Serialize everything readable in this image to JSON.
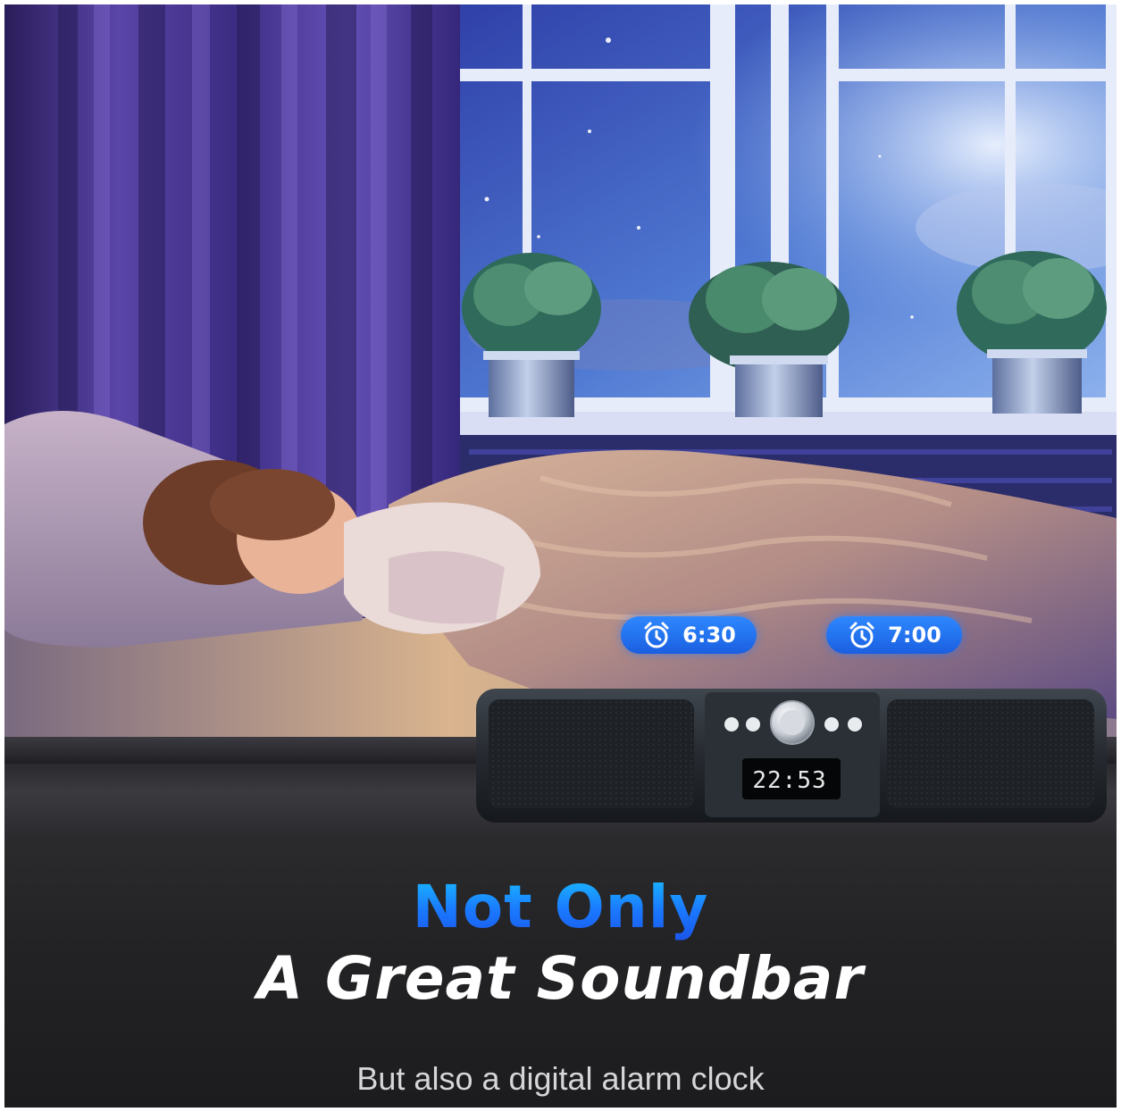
{
  "headline": {
    "line1": "Not Only",
    "line2": "A Great Soundbar",
    "subline": "But also a digital alarm clock"
  },
  "alarms": [
    {
      "time": "6:30",
      "icon": "alarm-clock-icon"
    },
    {
      "time": "7:00",
      "icon": "alarm-clock-icon"
    }
  ],
  "soundbar": {
    "display_time": "22:53"
  },
  "colors": {
    "accent_blue": "#1a78ff",
    "headline_white": "#ffffff",
    "panel_dark": "#232325"
  }
}
